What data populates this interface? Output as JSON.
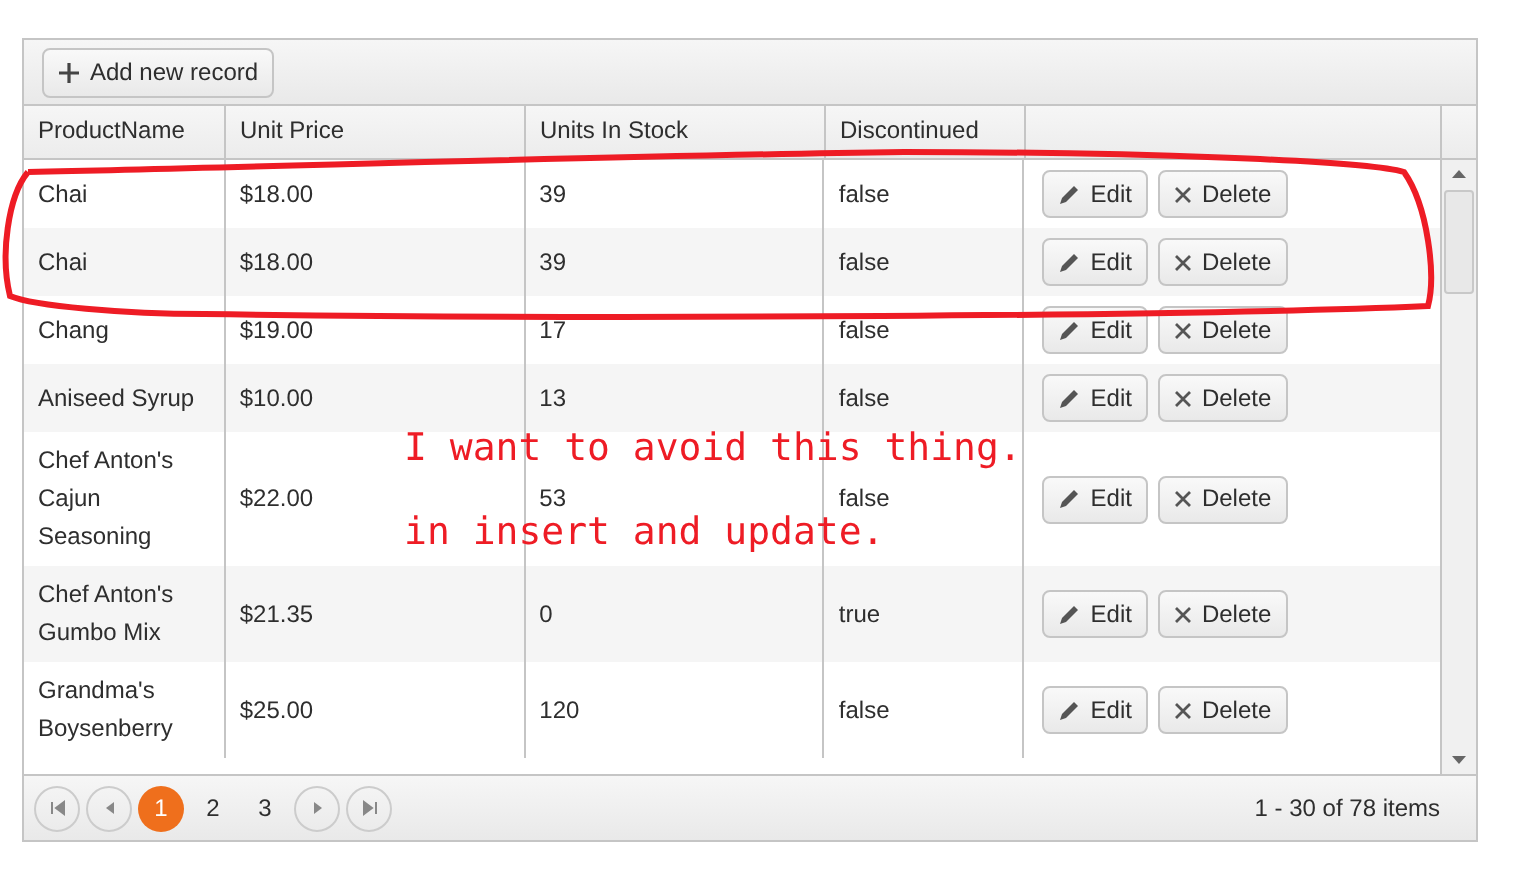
{
  "toolbar": {
    "add_button": "Add new record"
  },
  "columns": [
    "ProductName",
    "Unit Price",
    "Units In Stock",
    "Discontinued"
  ],
  "rows": [
    {
      "name": "Chai",
      "price": "$18.00",
      "stock": "39",
      "discontinued": "false",
      "edit": "Edit",
      "delete": "Delete"
    },
    {
      "name": "Chai",
      "price": "$18.00",
      "stock": "39",
      "discontinued": "false",
      "edit": "Edit",
      "delete": "Delete"
    },
    {
      "name": "Chang",
      "price": "$19.00",
      "stock": "17",
      "discontinued": "false",
      "edit": "Edit",
      "delete": "Delete"
    },
    {
      "name": "Aniseed Syrup",
      "price": "$10.00",
      "stock": "13",
      "discontinued": "false",
      "edit": "Edit",
      "delete": "Delete"
    },
    {
      "name": "Chef Anton's Cajun Seasoning",
      "price": "$22.00",
      "stock": "53",
      "discontinued": "false",
      "edit": "Edit",
      "delete": "Delete"
    },
    {
      "name": "Chef Anton's Gumbo Mix",
      "price": "$21.35",
      "stock": "0",
      "discontinued": "true",
      "edit": "Edit",
      "delete": "Delete"
    },
    {
      "name": "Grandma's Boysenberry",
      "price": "$25.00",
      "stock": "120",
      "discontinued": "false",
      "edit": "Edit",
      "delete": "Delete"
    }
  ],
  "pager": {
    "pages": [
      {
        "label": "1",
        "selected": true
      },
      {
        "label": "2",
        "selected": false
      },
      {
        "label": "3",
        "selected": false
      }
    ],
    "info": "1 - 30 of 78 items"
  },
  "annotation": {
    "lines": [
      "I want to avoid this thing.",
      "in insert and update."
    ]
  }
}
